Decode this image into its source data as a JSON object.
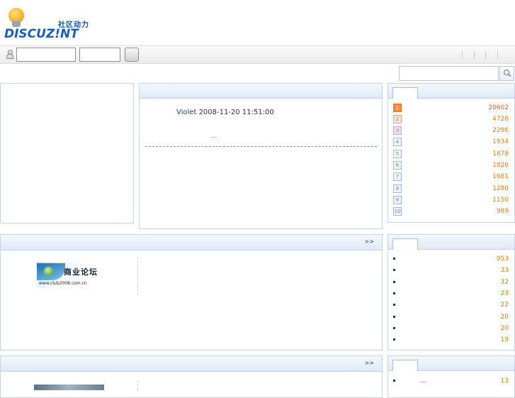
{
  "logo": {
    "tagline": "社区动力",
    "wordmark": "DISCUZ!NT"
  },
  "search": {
    "placeholder": ""
  },
  "announcement": {
    "author": "Violet",
    "datetime": "2008-11-20 11:51:00",
    "ellipsis": "..."
  },
  "more_link": ">>",
  "ranking1": {
    "values": [
      "20602",
      "4726",
      "2296",
      "1934",
      "1878",
      "1826",
      "1681",
      "1280",
      "1150",
      "989"
    ]
  },
  "ranking2": {
    "values": [
      "953",
      "33",
      "32",
      "23",
      "22",
      "20",
      "20",
      "19"
    ]
  },
  "ranking3": {
    "text": "...",
    "value": "13"
  },
  "banner": {
    "title": "商业论坛",
    "url": "www.club2008.com.cn"
  }
}
